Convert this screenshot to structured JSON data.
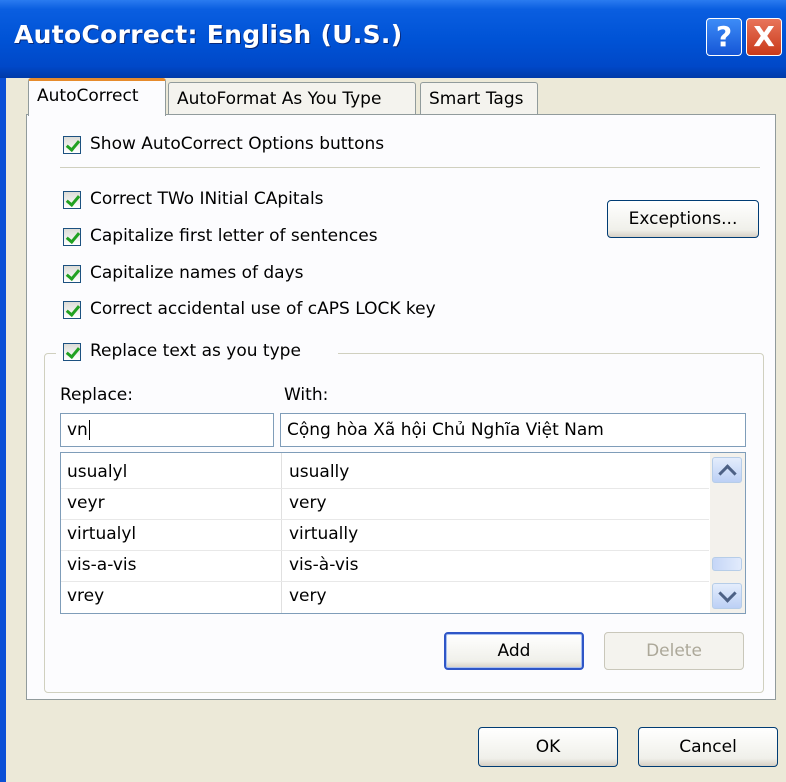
{
  "window": {
    "title": "AutoCorrect: English (U.S.)",
    "help_label": "?",
    "close_label": "X"
  },
  "tabs": [
    {
      "label": "AutoCorrect",
      "active": true
    },
    {
      "label": "AutoFormat As You Type",
      "active": false
    },
    {
      "label": "Smart Tags",
      "active": false
    }
  ],
  "options": {
    "show_buttons": {
      "label": "Show AutoCorrect Options buttons",
      "checked": true
    },
    "two_initial": {
      "label": "Correct TWo INitial CApitals",
      "checked": true
    },
    "first_letter": {
      "label": "Capitalize first letter of sentences",
      "checked": true
    },
    "names_days": {
      "label": "Capitalize names of days",
      "checked": true
    },
    "caps_lock": {
      "label": "Correct accidental use of cAPS LOCK key",
      "checked": true
    },
    "replace_text": {
      "label": "Replace text as you type",
      "checked": true
    }
  },
  "exceptions_label": "Exceptions...",
  "replace": {
    "replace_label": "Replace:",
    "with_label": "With:",
    "replace_value": "vn",
    "with_value": "Cộng hòa Xã hội Chủ Nghĩa Việt Nam"
  },
  "entries": [
    {
      "from": "usualyl",
      "to": "usually"
    },
    {
      "from": "veyr",
      "to": "very"
    },
    {
      "from": "virtualyl",
      "to": "virtually"
    },
    {
      "from": "vis-a-vis",
      "to": "vis-à-vis"
    },
    {
      "from": "vrey",
      "to": "very"
    }
  ],
  "buttons": {
    "add": "Add",
    "delete": "Delete",
    "ok": "OK",
    "cancel": "Cancel"
  },
  "colors": {
    "titlebar": "#0053d6",
    "face": "#ece9d8",
    "check": "#21a121",
    "tab_accent": "#e68b2c"
  }
}
